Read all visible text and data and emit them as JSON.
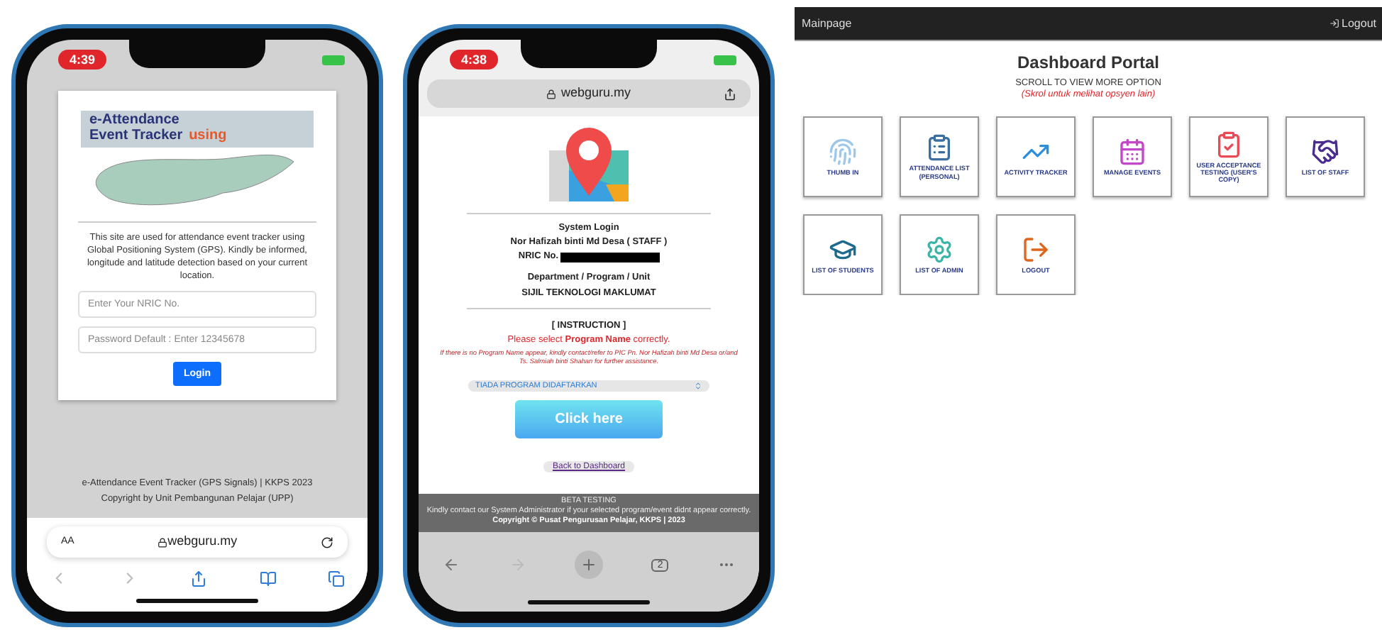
{
  "login_phone": {
    "time": "4:39",
    "logo": {
      "line_1": "e-Attendance",
      "line_2": "Event Tracker",
      "line_3": "using"
    },
    "description": "This site are used for attendance event tracker using Global Positioning System (GPS). Kindly be informed, longitude and latitude detection based on your current location.",
    "nric_field": {
      "placeholder": "Enter Your NRIC No."
    },
    "password_field": {
      "placeholder": "Password Default : Enter 12345678"
    },
    "login_button": "Login",
    "footer": [
      "e-Attendance Event Tracker (GPS Signals) | KKPS 2023",
      "Copyright by Unit Pembangunan Pelajar (UPP)"
    ],
    "browser": {
      "text_size": "AA",
      "url": "webguru.my"
    }
  },
  "program_phone": {
    "time": "4:38",
    "url": "webguru.my",
    "heading": "System Login",
    "name": "Nor Hafizah binti Md Desa ( STAFF )",
    "nric_label": "NRIC No.",
    "department_label": "Department / Program / Unit",
    "department": "SIJIL TEKNOLOGI MAKLUMAT",
    "instruction_title": "[ INSTRUCTION ]",
    "instruction": "Please select **Program Name** correctly.",
    "note": "If there is no Program Name appear, kindly contact/refer to PIC Pn. Nor Hafizah binti Md Desa or/and Ts. Salmiah binti Shahan for further assistance.",
    "program_select": {
      "value": "TIADA PROGRAM DIDAFTARKAN"
    },
    "submit_button": "Click here",
    "back_link": "Back to Dashboard",
    "footer": {
      "title": "BETA TESTING",
      "message": "Kindly contact our System Administrator if your selected program/event didnt appear correctly.",
      "copyright": "Copyright © Pusat Pengurusan Pelajar, KKPS | 2023"
    },
    "tab_count": "2"
  },
  "dashboard": {
    "nav": {
      "brand": "Mainpage",
      "logout": "Logout"
    },
    "title": "Dashboard Portal",
    "subtitle": "SCROLL TO VIEW MORE OPTION",
    "subtitle_malay": "(Skrol untuk melihat opsyen lain)",
    "tiles": [
      {
        "kind": "thumb",
        "label": "THUMB IN"
      },
      {
        "kind": "attendance",
        "label": "ATTENDANCE LIST (PERSONAL)"
      },
      {
        "kind": "activity",
        "label": "ACTIVITY TRACKER"
      },
      {
        "kind": "events",
        "label": "MANAGE EVENTS"
      },
      {
        "kind": "testing",
        "label": "USER ACCEPTANCE TESTING (USER'S COPY)"
      },
      {
        "kind": "staff",
        "label": "LIST OF STAFF"
      },
      {
        "kind": "students",
        "label": "LIST OF STUDENTS"
      },
      {
        "kind": "admin",
        "label": "LIST OF ADMIN"
      },
      {
        "kind": "logout",
        "label": "LOGOUT"
      }
    ]
  }
}
